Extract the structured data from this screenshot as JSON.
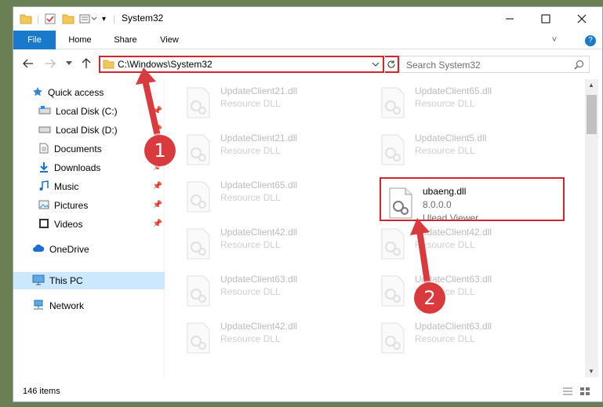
{
  "window": {
    "title": "System32",
    "minimize_icon": "minimize-icon",
    "maximize_icon": "maximize-icon",
    "close_icon": "close-icon"
  },
  "ribbon": {
    "tabs": [
      {
        "label": "File"
      },
      {
        "label": "Home"
      },
      {
        "label": "Share"
      },
      {
        "label": "View"
      }
    ],
    "help": "?"
  },
  "address": {
    "path": "C:\\Windows\\System32"
  },
  "search": {
    "placeholder": "Search System32"
  },
  "sidebar": {
    "items": [
      {
        "label": "Quick access",
        "icon": "star-icon"
      },
      {
        "label": "Local Disk (C:)",
        "icon": "drive-icon"
      },
      {
        "label": "Local Disk (D:)",
        "icon": "drive-icon"
      },
      {
        "label": "Documents",
        "icon": "documents-icon"
      },
      {
        "label": "Downloads",
        "icon": "download-icon"
      },
      {
        "label": "Music",
        "icon": "music-icon"
      },
      {
        "label": "Pictures",
        "icon": "pictures-icon"
      },
      {
        "label": "Videos",
        "icon": "videos-icon"
      },
      {
        "label": "OneDrive",
        "icon": "cloud-icon"
      },
      {
        "label": "This PC",
        "icon": "computer-icon"
      },
      {
        "label": "Network",
        "icon": "network-icon"
      }
    ]
  },
  "files": [
    {
      "name": "UpdateClient21.dll",
      "type": "Resource DLL"
    },
    {
      "name": "UpdateClient65.dll",
      "type": "Resource DLL"
    },
    {
      "name": "UpdateClient21.dll",
      "type": "Resource DLL"
    },
    {
      "name": "UpdateClient5.dll",
      "type": "Resource DLL"
    },
    {
      "name": "UpdateClient65.dll",
      "type": "Resource DLL"
    },
    {
      "name": "ubaeng.dll",
      "version": "8.0.0.0",
      "type": "Ulead Viewer"
    },
    {
      "name": "UpdateClient42.dll",
      "type": "Resource DLL"
    },
    {
      "name": "UpdateClient42.dll",
      "type": "Resource DLL"
    },
    {
      "name": "UpdateClient63.dll",
      "type": "Resource DLL"
    },
    {
      "name": "UpdateClient63.dll",
      "type": "Resource DLL"
    },
    {
      "name": "UpdateClient42.dll",
      "type": "Resource DLL"
    },
    {
      "name": "UpdateClient63.dll",
      "type": "Resource DLL"
    }
  ],
  "status": {
    "count": "146 items"
  },
  "annotations": {
    "step1": "1",
    "step2": "2",
    "color": "#d83a3d"
  }
}
